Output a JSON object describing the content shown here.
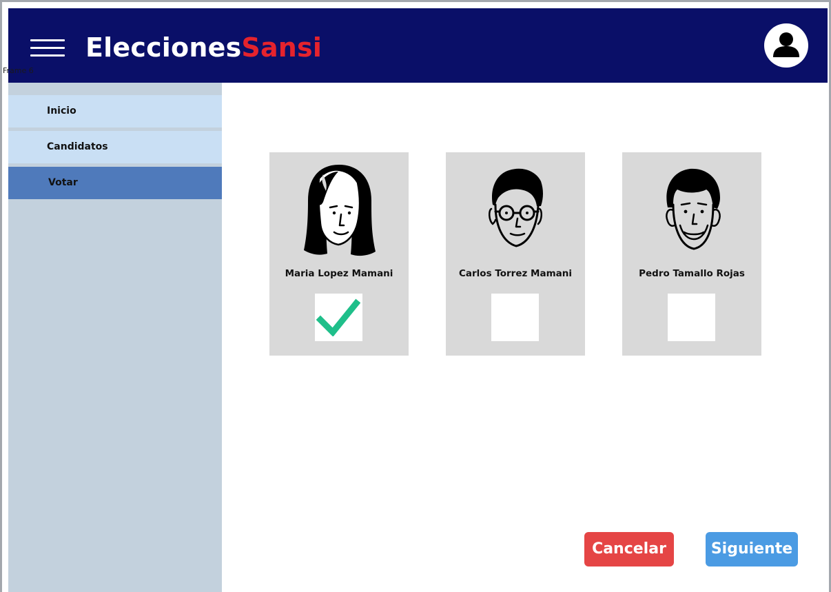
{
  "frame_label": "Frame 6",
  "header": {
    "brand_part1": "Elecciones",
    "brand_part2": "Sansi",
    "menu_icon": "hamburger-menu-icon",
    "avatar_icon": "user-avatar-icon"
  },
  "sidebar": {
    "items": [
      {
        "label": "Inicio",
        "active": false
      },
      {
        "label": "Candidatos",
        "active": false
      },
      {
        "label": "Votar",
        "active": true
      }
    ]
  },
  "candidates": [
    {
      "name": "Maria Lopez Mamani",
      "selected": true
    },
    {
      "name": "Carlos Torrez Mamani",
      "selected": false
    },
    {
      "name": "Pedro Tamallo Rojas",
      "selected": false
    }
  ],
  "actions": {
    "cancel_label": "Cancelar",
    "next_label": "Siguiente"
  },
  "colors": {
    "header_bg": "#0a0f68",
    "brand_accent": "#e5232d",
    "sidebar_bg": "#c3d1dd",
    "nav_item_bg": "#c9dff4",
    "nav_active_bg": "#4f7abb",
    "card_bg": "#d9d9d9",
    "check_color": "#1fbf8a",
    "cancel_bg": "#e54545",
    "next_bg": "#4b9be3"
  }
}
